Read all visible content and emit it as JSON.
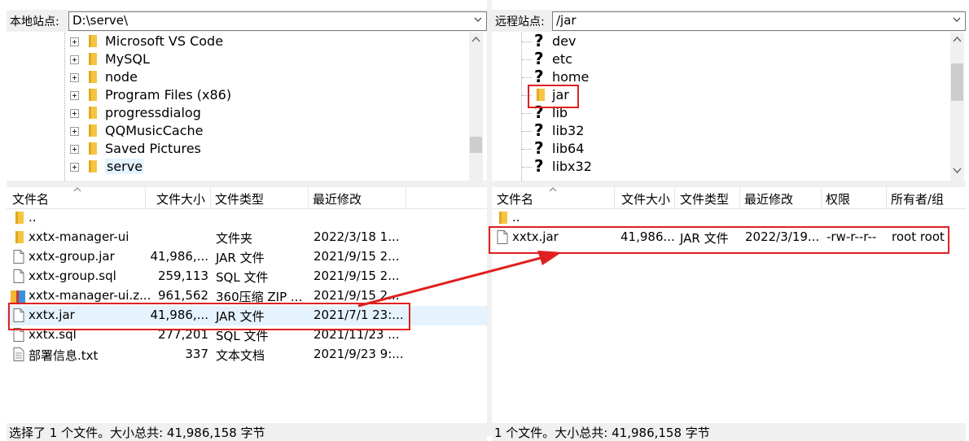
{
  "local": {
    "site_label": "本地站点:",
    "path": "D:\\serve\\",
    "tree": [
      "Microsoft VS Code",
      "MySQL",
      "node",
      "Program Files (x86)",
      "progressdialog",
      "QQMusicCache",
      "Saved Pictures",
      "serve"
    ],
    "columns": [
      "文件名",
      "文件大小",
      "文件类型",
      "最近修改"
    ],
    "files": [
      {
        "name": "..",
        "size": "",
        "type": "",
        "modified": "",
        "icon": "folder"
      },
      {
        "name": "xxtx-manager-ui",
        "size": "",
        "type": "文件夹",
        "modified": "2022/3/18 1...",
        "icon": "folder"
      },
      {
        "name": "xxtx-group.jar",
        "size": "41,986,...",
        "type": "JAR 文件",
        "modified": "2021/9/15 2...",
        "icon": "file"
      },
      {
        "name": "xxtx-group.sql",
        "size": "259,113",
        "type": "SQL 文件",
        "modified": "2021/9/15 2...",
        "icon": "file"
      },
      {
        "name": "xxtx-manager-ui.z...",
        "size": "961,562",
        "type": "360压缩 ZIP ...",
        "modified": "2021/9/15 2...",
        "icon": "zip"
      },
      {
        "name": "xxtx.jar",
        "size": "41,986,...",
        "type": "JAR 文件",
        "modified": "2021/7/1 23:...",
        "icon": "file"
      },
      {
        "name": "xxtx.sql",
        "size": "277,201",
        "type": "SQL 文件",
        "modified": "2021/11/23 ...",
        "icon": "file"
      },
      {
        "name": "部署信息.txt",
        "size": "337",
        "type": "文本文档",
        "modified": "2021/9/23 9:...",
        "icon": "txt"
      }
    ],
    "status": "选择了 1 个文件。大小总共: 41,986,158 字节"
  },
  "remote": {
    "site_label": "远程站点:",
    "path": "/jar",
    "tree": [
      "dev",
      "etc",
      "home",
      "jar",
      "lib",
      "lib32",
      "lib64",
      "libx32"
    ],
    "columns": [
      "文件名",
      "文件大小",
      "文件类型",
      "最近修改",
      "权限",
      "所有者/组"
    ],
    "files": [
      {
        "name": "..",
        "size": "",
        "type": "",
        "modified": "",
        "perm": "",
        "owner": "",
        "icon": "folder"
      },
      {
        "name": "xxtx.jar",
        "size": "41,986...",
        "type": "JAR 文件",
        "modified": "2022/3/19...",
        "perm": "-rw-r--r--",
        "owner": "root root",
        "icon": "file"
      }
    ],
    "status": "1 个文件。大小总共: 41,986,158 字节"
  },
  "colors": {
    "highlight": "#e02020",
    "folder": "#f5c542",
    "selection": "#e5f3ff"
  }
}
